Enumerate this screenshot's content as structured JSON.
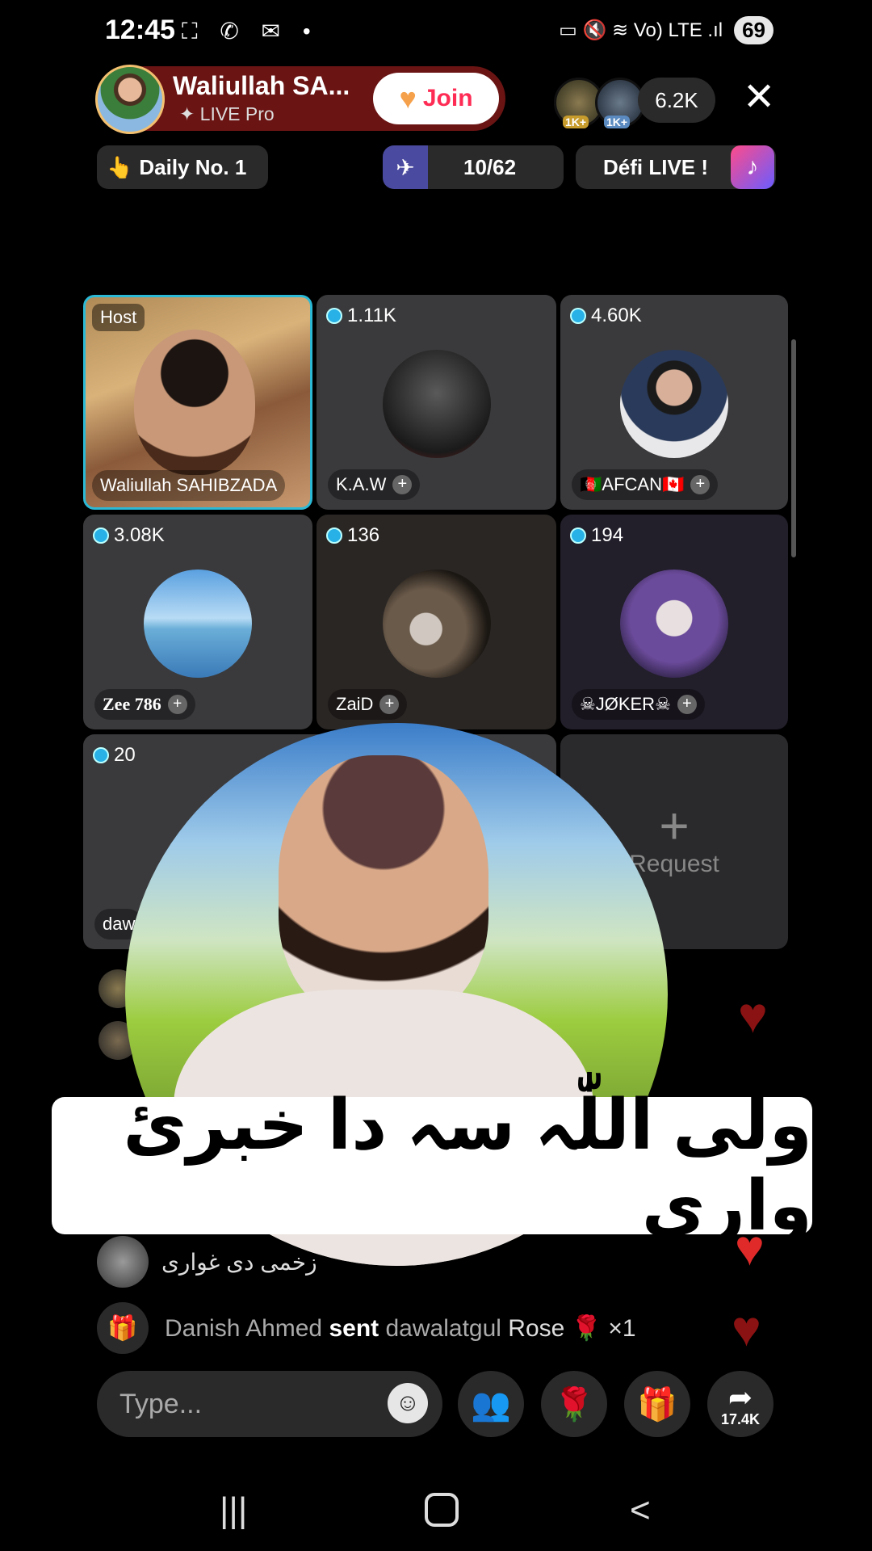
{
  "status_bar": {
    "time": "12:45",
    "icons": "⛶ ✆ ✉ •",
    "right_icons": "▭ 🔇 ≋ Vo) LTE .ıl",
    "battery": "69"
  },
  "host": {
    "name": "Waliullah SA...",
    "subtitle": "✦ LIVE Pro",
    "join_label": "Join",
    "viewer_badge_1": "1K+",
    "viewer_badge_2": "1K+",
    "viewer_count": "6.2K"
  },
  "info_row": {
    "daily": "Daily No. 1",
    "daily_icon": "👆",
    "progress": "10/62",
    "challenge": "Défi LIVE !"
  },
  "grid": {
    "host_tile": {
      "tag": "Host",
      "name": "Waliullah SAHIBZADA"
    },
    "tiles": [
      {
        "score": "1.11K",
        "name": "K.A.W"
      },
      {
        "score": "4.60K",
        "name": "🇦🇫AFCAN🇨🇦"
      },
      {
        "score": "3.08K",
        "name": "Zee 786"
      },
      {
        "score": "136",
        "name": "ZaiD"
      },
      {
        "score": "194",
        "name": "☠JØKER☠"
      },
      {
        "score": "20",
        "name": "daw"
      }
    ],
    "request_label": "Request"
  },
  "overlay": {
    "banner_text": "ولی اللّٰہ سہ دا خبرئ واری"
  },
  "chat": {
    "comment_text": "زخمی دی غواری",
    "gift_sender": "Danish Ahmed",
    "gift_verb": "sent",
    "gift_receiver": "dawalatgul",
    "gift_item": "Rose 🌹 ×1"
  },
  "bottom_bar": {
    "type_placeholder": "Type...",
    "share_count": "17.4K"
  },
  "colors": {
    "accent": "#fe2c55",
    "host_pill": "#6b1414",
    "tile_bg": "#3a3a3c",
    "heart": "#8b1212"
  }
}
